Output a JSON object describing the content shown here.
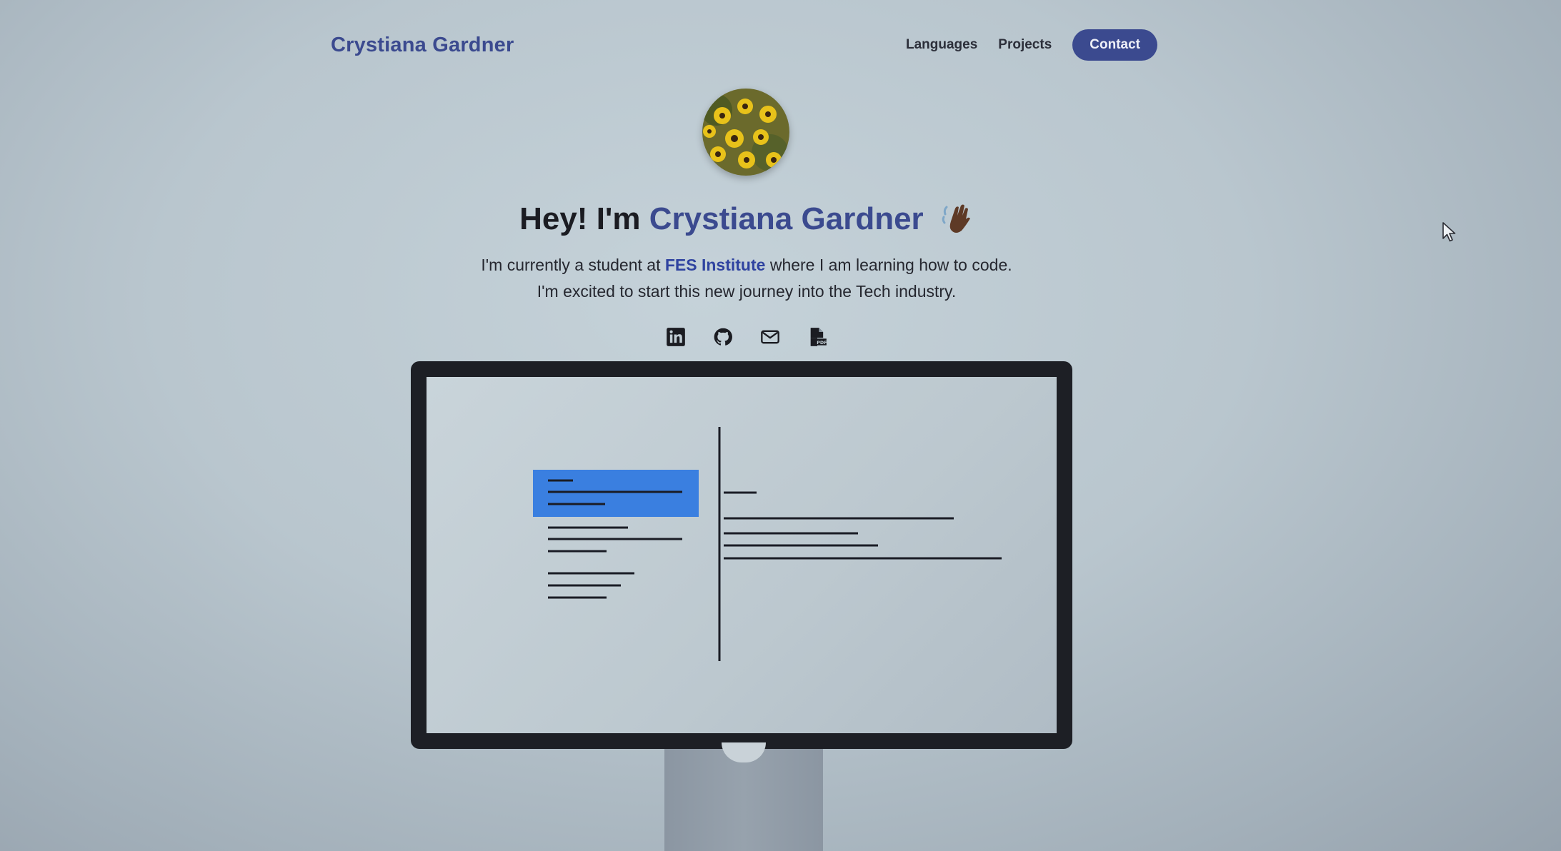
{
  "nav": {
    "brand": "Crystiana Gardner",
    "links": [
      "Languages",
      "Projects"
    ],
    "contact_label": "Contact"
  },
  "hero": {
    "greeting": "Hey! I'm",
    "name": "Crystiana Gardner",
    "intro_before": "I'm currently a student at",
    "institute": "FES Institute",
    "intro_after": "where I am learning how to code. I'm excited to start this new journey into the Tech industry."
  },
  "socials": [
    {
      "icon": "linkedin-icon"
    },
    {
      "icon": "github-icon"
    },
    {
      "icon": "mail-icon"
    },
    {
      "icon": "pdf-resume-icon"
    }
  ],
  "colors": {
    "accent": "#3b4a8f",
    "institute_link": "#2f43a0",
    "selected_item": "#3a7fe0",
    "monitor_frame": "#1d1f25"
  }
}
